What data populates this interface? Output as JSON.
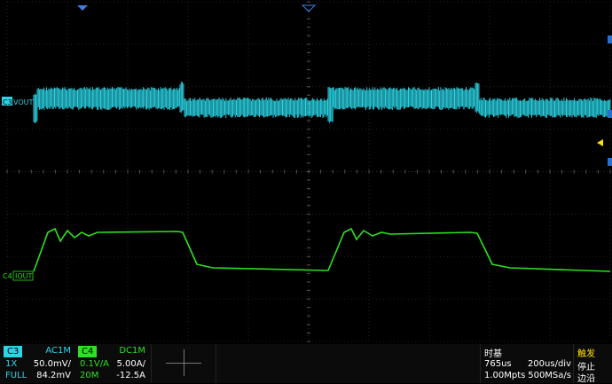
{
  "channels": {
    "c3": {
      "name": "C3",
      "label": "VOUT",
      "coupling": "AC1M",
      "probe": "1X",
      "scale": "50.0mV/",
      "bandwidth": "FULL",
      "offset": "84.2mV",
      "color": "#2ad5e6"
    },
    "c4": {
      "name": "C4",
      "label": "IOUT",
      "coupling": "DC1M",
      "probe": "0.1V/A",
      "scale": "5.00A/",
      "bandwidth": "20M",
      "offset": "-12.5A",
      "color": "#2ee01f"
    }
  },
  "timebase": {
    "title": "时基",
    "delay": "765us",
    "scale": "200us/div",
    "memory": "1.00Mpts",
    "sample_rate": "500MSa/s"
  },
  "trigger": {
    "title": "触发",
    "status": "停止",
    "mode": "边沿",
    "color": "#ffe000"
  }
}
